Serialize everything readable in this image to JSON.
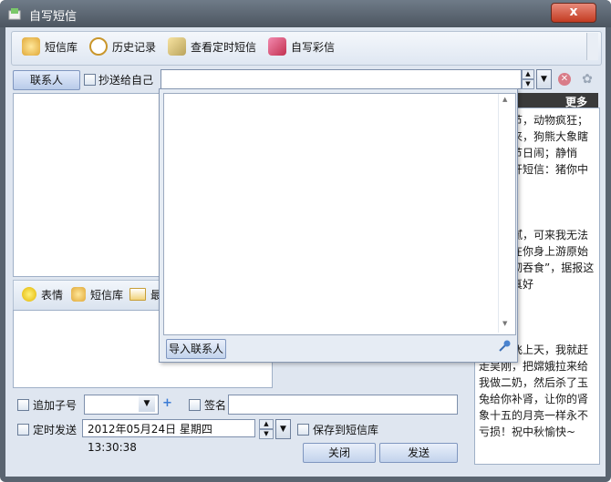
{
  "window": {
    "title": "自写短信",
    "close_glyph": "x"
  },
  "toolbar": {
    "items": [
      {
        "label": "短信库",
        "icon": "sms-library-icon",
        "color": "#e8b84a"
      },
      {
        "label": "历史记录",
        "icon": "clock-icon",
        "color": "#d9a32b"
      },
      {
        "label": "查看定时短信",
        "icon": "scheduled-sms-icon",
        "color": "#c9b36a"
      },
      {
        "label": "自写彩信",
        "icon": "mms-icon",
        "color": "#d44c7a"
      }
    ]
  },
  "contacts": {
    "button_label": "联系人",
    "cc_self_label": "抄送给自己",
    "recipient_value": "",
    "spin_up": "▲",
    "spin_down": "▼",
    "dropdown": "▼",
    "clear_glyph": "✕",
    "gear_glyph": "✿"
  },
  "tools": {
    "emoji_label": "表情",
    "sms_lib_label": "短信库",
    "truncated_label": "最"
  },
  "right_panel": {
    "more_label": "更多",
    "messages": [
      "五中秋节，动物疯狂；狮子吼来，狗熊大象瞎胡来把节日闹；静悄悄，打开短信：猪你中秋",
      "有些油腻，可来我无法抗拒，在你身上游原始的欲望彻吞食”，据报这块月饼真好",
      "如果我飞上天，我就赶走吴刚，把嫦娥拉来给我做二奶，然后杀了玉兔给你补肾，让你的肾象十五的月亮一样永不亏损！祝中秋愉快~"
    ]
  },
  "popup": {
    "import_label": "导入联系人",
    "pin_glyph": "📌",
    "scroll_up": "▲",
    "scroll_down": "▼"
  },
  "bottom": {
    "subnum_label": "追加子号",
    "subnum_value": "",
    "plus_glyph": "+",
    "signature_label": "签名",
    "signature_value": "",
    "schedule_label": "定时发送",
    "datetime_value": "2012年05月24日 星期四 13:30:38",
    "save_label": "保存到短信库",
    "close_label": "关闭",
    "send_label": "发送"
  }
}
